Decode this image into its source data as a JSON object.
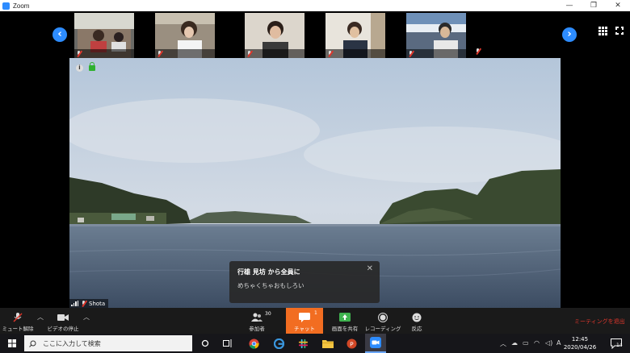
{
  "window": {
    "title": "Zoom",
    "controls": {
      "minimize": "—",
      "restore": "❐",
      "close": "✕"
    }
  },
  "gallery": {
    "participants": [
      {
        "name": ""
      },
      {
        "name": ""
      },
      {
        "name": ""
      },
      {
        "name": ""
      },
      {
        "name": ""
      },
      {
        "name": ""
      }
    ],
    "prev_icon": "chevron-left-icon",
    "next_icon": "chevron-right-icon"
  },
  "main_video": {
    "speaker_name": "Shota"
  },
  "chat_popup": {
    "sender": "行雄 見坊 から全員に",
    "message": "めちゃくちゃおもしろい",
    "close": "✕"
  },
  "controls": {
    "mute": "ミュート解除",
    "stop_video": "ビデオの停止",
    "participants": "参加者",
    "participants_count": "30",
    "chat": "チャット",
    "chat_count": "1",
    "share": "画面を共有",
    "record": "レコーディング",
    "reactions": "反応",
    "leave": "ミーティングを退出"
  },
  "taskbar": {
    "search_placeholder": "ここに入力して検索",
    "time": "12:45",
    "date": "2020/04/26",
    "notifications": "14",
    "ime": "A"
  },
  "colors": {
    "accent": "#2d8cff",
    "chat_active": "#f26d21",
    "leave": "#e0372c",
    "mic_off": "#e0372c"
  }
}
